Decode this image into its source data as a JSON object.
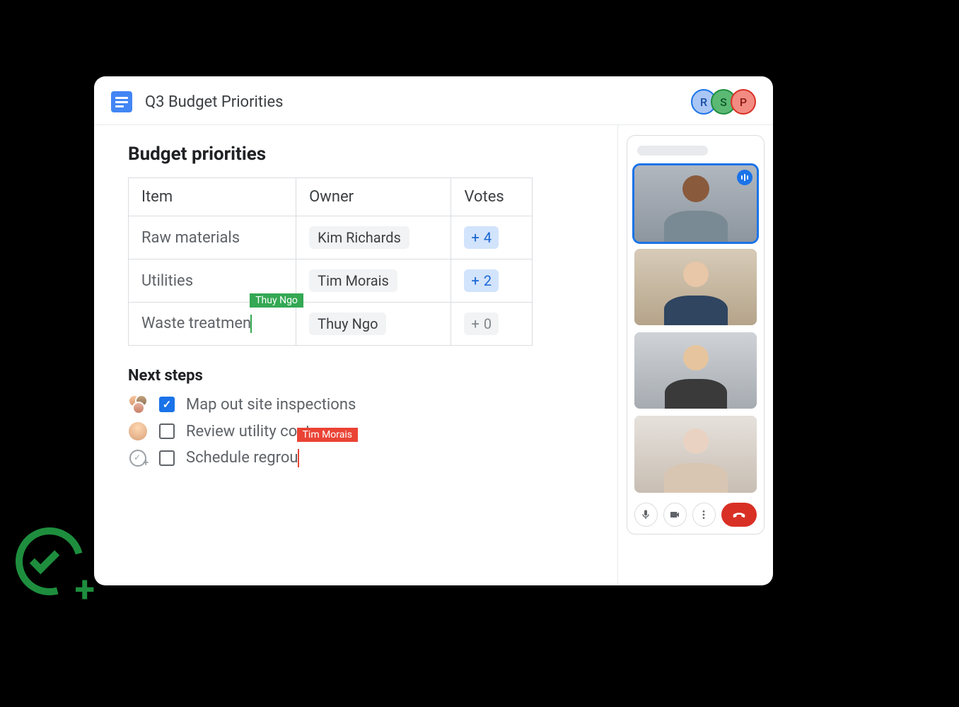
{
  "header": {
    "doc_title": "Q3 Budget Priorities",
    "collaborators": [
      {
        "initial": "R",
        "color": "blue"
      },
      {
        "initial": "S",
        "color": "green"
      },
      {
        "initial": "P",
        "color": "red"
      }
    ]
  },
  "sections": {
    "priorities": {
      "heading": "Budget priorities",
      "columns": {
        "item": "Item",
        "owner": "Owner",
        "votes": "Votes"
      },
      "rows": [
        {
          "item": "Raw materials",
          "owner": "Kim Richards",
          "votes": 4,
          "vote_style": "blue"
        },
        {
          "item": "Utilities",
          "owner": "Tim Morais",
          "votes": 2,
          "vote_style": "blue"
        },
        {
          "item": "Waste treatmen",
          "owner": "Thuy Ngo",
          "votes": 0,
          "vote_style": "gray"
        }
      ],
      "cursor_in_row": {
        "row_index": 2,
        "editor": "Thuy Ngo",
        "color": "#34a853"
      }
    },
    "next_steps": {
      "heading": "Next steps",
      "tasks": [
        {
          "text": "Map out site inspections",
          "checked": true,
          "assignee_type": "group"
        },
        {
          "text": "Review utility costs",
          "checked": false,
          "assignee_type": "single"
        },
        {
          "text": "Schedule regrou",
          "checked": false,
          "assignee_type": "unassigned"
        }
      ],
      "cursor_in_task": {
        "task_index": 2,
        "editor": "Tim Morais",
        "color": "#ea4335"
      }
    }
  },
  "meet": {
    "participants": [
      {
        "speaking": true
      },
      {
        "speaking": false
      },
      {
        "speaking": false
      },
      {
        "speaking": false
      }
    ],
    "controls": {
      "mic": "mic-icon",
      "camera": "camera-icon",
      "more": "more-icon",
      "hangup": "hangup-icon"
    }
  }
}
